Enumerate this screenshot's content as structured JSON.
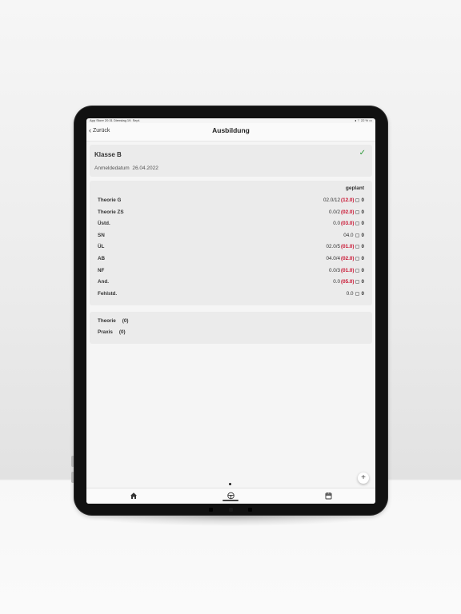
{
  "status_bar": {
    "left": "App Store  20:31  Dienstag 19. Sept.",
    "right": "◂ ⌔ 22 % ▭"
  },
  "nav": {
    "back_label": "Zurück",
    "title": "Ausbildung"
  },
  "license": {
    "class_label": "Klasse B",
    "date_label": "Anmeldedatum",
    "date_value": "26.04.2022"
  },
  "lessons": {
    "column_label": "geplant",
    "rows": [
      {
        "name": "Theorie G",
        "done": "02.0/12",
        "planned": "(12.0)",
        "count": "0"
      },
      {
        "name": "Theorie ZS",
        "done": "0.0/2",
        "planned": "(02.0)",
        "count": "0"
      },
      {
        "name": "Üstd.",
        "done": "0.0",
        "planned": "(03.0)",
        "count": "0"
      },
      {
        "name": "SN",
        "done": "04.0",
        "planned": "",
        "count": "0"
      },
      {
        "name": "ÜL",
        "done": "02.0/5",
        "planned": "(01.0)",
        "count": "0"
      },
      {
        "name": "AB",
        "done": "04.0/4",
        "planned": "(02.0)",
        "count": "0"
      },
      {
        "name": "NF",
        "done": "0.0/3",
        "planned": "(01.0)",
        "count": "0"
      },
      {
        "name": "And.",
        "done": "0.0",
        "planned": "(05.0)",
        "count": "0"
      },
      {
        "name": "Fehlstd.",
        "done": "0.0",
        "planned": "",
        "count": "0"
      }
    ]
  },
  "summary": [
    {
      "name": "Theorie",
      "value": "(0)"
    },
    {
      "name": "Praxis",
      "value": "(0)"
    }
  ],
  "fab_label": "+",
  "tabs": [
    {
      "icon": "home-icon"
    },
    {
      "icon": "steering-wheel-icon"
    },
    {
      "icon": "calendar-icon"
    }
  ],
  "colors": {
    "accent_red": "#c8102e",
    "check_green": "#2e9a3a"
  }
}
